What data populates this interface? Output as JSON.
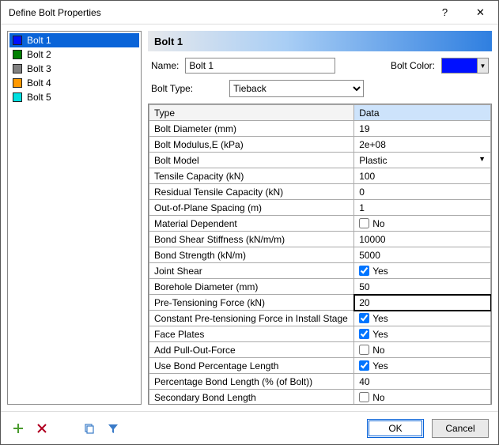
{
  "window": {
    "title": "Define Bolt Properties"
  },
  "sidebar": {
    "items": [
      {
        "label": "Bolt 1",
        "color": "#0010ff",
        "selected": true
      },
      {
        "label": "Bolt 2",
        "color": "#008000",
        "selected": false
      },
      {
        "label": "Bolt 3",
        "color": "#808080",
        "selected": false
      },
      {
        "label": "Bolt 4",
        "color": "#ff9900",
        "selected": false
      },
      {
        "label": "Bolt 5",
        "color": "#00e0e0",
        "selected": false
      }
    ]
  },
  "main": {
    "heading": "Bolt 1",
    "name_label": "Name:",
    "name_value": "Bolt 1",
    "color_label": "Bolt Color:",
    "color_value": "#0010ff",
    "type_label": "Bolt Type:",
    "type_value": "Tieback",
    "columns": {
      "type": "Type",
      "data": "Data"
    },
    "rows": [
      {
        "label": "Bolt Diameter (mm)",
        "kind": "text",
        "value": "19"
      },
      {
        "label": "Bolt Modulus,E (kPa)",
        "kind": "text",
        "value": "2e+08"
      },
      {
        "label": "Bolt Model",
        "kind": "dropdown",
        "value": "Plastic"
      },
      {
        "label": "Tensile Capacity (kN)",
        "kind": "text",
        "value": "100"
      },
      {
        "label": "Residual Tensile Capacity (kN)",
        "kind": "text",
        "value": "0"
      },
      {
        "label": "Out-of-Plane Spacing (m)",
        "kind": "text",
        "value": "1"
      },
      {
        "label": "Material Dependent",
        "kind": "check",
        "value": false,
        "text": "No"
      },
      {
        "label": "Bond Shear Stiffness (kN/m/m)",
        "kind": "text",
        "value": "10000"
      },
      {
        "label": "Bond Strength (kN/m)",
        "kind": "text",
        "value": "5000"
      },
      {
        "label": "Joint Shear",
        "kind": "check",
        "value": true,
        "text": "Yes"
      },
      {
        "label": "Borehole Diameter (mm)",
        "kind": "text",
        "value": "50"
      },
      {
        "label": "Pre-Tensioning Force (kN)",
        "kind": "text",
        "value": "20",
        "editing": true
      },
      {
        "label": "Constant Pre-tensioning Force in Install Stage",
        "kind": "check",
        "value": true,
        "text": "Yes"
      },
      {
        "label": "Face Plates",
        "kind": "check",
        "value": true,
        "text": "Yes"
      },
      {
        "label": "Add Pull-Out-Force",
        "kind": "check",
        "value": false,
        "text": "No"
      },
      {
        "label": "Use Bond Percentage Length",
        "kind": "check",
        "value": true,
        "text": "Yes"
      },
      {
        "label": "Percentage Bond Length (% (of Bolt))",
        "kind": "text",
        "value": "40"
      },
      {
        "label": "Secondary Bond Length",
        "kind": "check",
        "value": false,
        "text": "No"
      }
    ]
  },
  "footer": {
    "ok": "OK",
    "cancel": "Cancel"
  }
}
